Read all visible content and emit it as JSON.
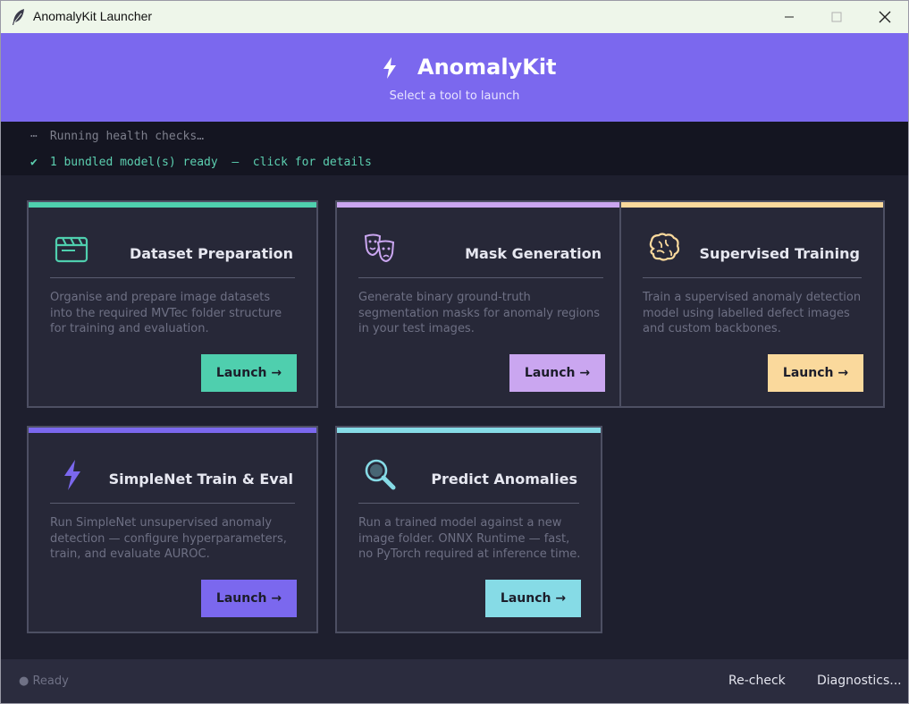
{
  "window": {
    "title": "AnomalyKit Launcher",
    "icon": "feather-icon"
  },
  "header": {
    "app_name": "AnomalyKit",
    "subtitle": "Select a tool to launch",
    "bg_color": "#7b68ee"
  },
  "console": {
    "line1_prefix": "⋯",
    "line1": "Running health checks…",
    "line2_prefix": "✔",
    "line2": "1 bundled model(s) ready  –  click for details"
  },
  "cards": [
    {
      "title": "Dataset Preparation",
      "icon": "clapperboard-icon",
      "accent": "#4fcfae",
      "description": "Organise and prepare image datasets into the required MVTec folder structure for training and evaluation.",
      "button": "Launch →"
    },
    {
      "title": "Mask Generation",
      "icon": "theater-masks-icon",
      "accent": "#caa6f0",
      "description": "Generate binary ground-truth segmentation masks for anomaly regions in your test images.",
      "button": "Launch →"
    },
    {
      "title": "Supervised Training",
      "icon": "brain-icon",
      "accent": "#fad99c",
      "description": "Train a supervised anomaly detection model using labelled defect images and custom backbones.",
      "button": "Launch →"
    },
    {
      "title": "SimpleNet Train & Eval",
      "icon": "lightning-icon",
      "accent": "#7b68ee",
      "description": "Run SimpleNet unsupervised anomaly detection — configure hyperparameters, train, and evaluate AUROC.",
      "button": "Launch →"
    },
    {
      "title": "Predict Anomalies",
      "icon": "magnifier-icon",
      "accent": "#86dbe6",
      "description": "Run a trained model against a new image folder. ONNX Runtime — fast, no PyTorch required at inference time.",
      "button": "Launch →"
    }
  ],
  "footer": {
    "status": "● Ready",
    "recheck": "Re-check",
    "diagnostics": "Diagnostics..."
  }
}
